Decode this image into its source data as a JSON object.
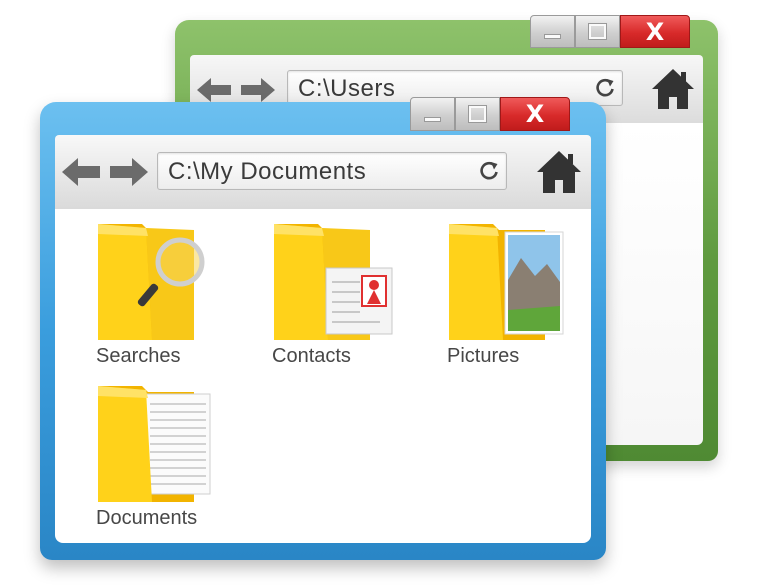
{
  "back_window": {
    "address": "C:\\Users",
    "close_label": "X",
    "frame_color": "#5f9a3f"
  },
  "front_window": {
    "address": "C:\\My Documents",
    "close_label": "X",
    "frame_color": "#2a86c6",
    "folders": [
      {
        "label": "Searches",
        "icon": "folder-magnifier-icon"
      },
      {
        "label": "Contacts",
        "icon": "folder-contact-card-icon"
      },
      {
        "label": "Pictures",
        "icon": "folder-photo-icon"
      },
      {
        "label": "Documents",
        "icon": "folder-papers-icon"
      }
    ]
  },
  "colors": {
    "folder": "#f5b800",
    "close": "#d82a2a"
  }
}
